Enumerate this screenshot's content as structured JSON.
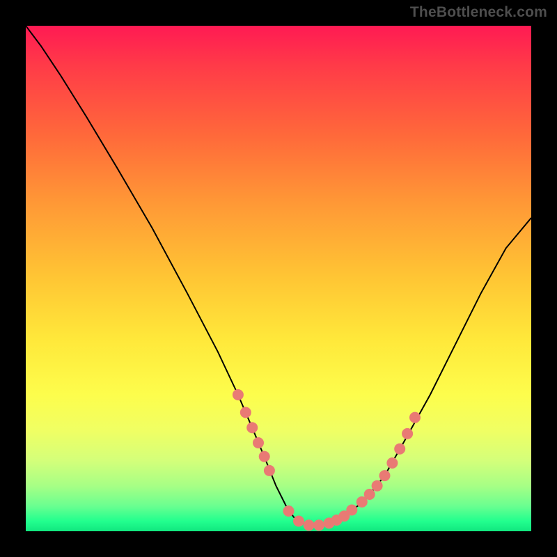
{
  "watermark": "TheBottleneck.com",
  "chart_data": {
    "type": "line",
    "title": "",
    "xlabel": "",
    "ylabel": "",
    "xlim": [
      0,
      100
    ],
    "ylim": [
      0,
      100
    ],
    "grid": false,
    "curve_color": "#000000",
    "marker_color": "#e97a74",
    "series": [
      {
        "name": "curve",
        "x": [
          0,
          3,
          7,
          12,
          18,
          25,
          32,
          38,
          42,
          45,
          47.5,
          49.5,
          51.5,
          53,
          55,
          57,
          60,
          63,
          67,
          71,
          75,
          80,
          85,
          90,
          95,
          100
        ],
        "y": [
          100,
          96,
          90,
          82,
          72,
          60,
          47,
          35.5,
          27,
          20,
          14,
          9,
          5,
          2.8,
          1.5,
          1.2,
          1.6,
          3,
          6,
          11,
          18,
          27,
          37,
          47,
          56,
          62
        ]
      }
    ],
    "markers": [
      {
        "x": 42.0,
        "y": 27.0
      },
      {
        "x": 43.5,
        "y": 23.5
      },
      {
        "x": 44.8,
        "y": 20.5
      },
      {
        "x": 46.0,
        "y": 17.5
      },
      {
        "x": 47.2,
        "y": 14.8
      },
      {
        "x": 48.2,
        "y": 12.0
      },
      {
        "x": 52.0,
        "y": 4.0
      },
      {
        "x": 54.0,
        "y": 2.0
      },
      {
        "x": 56.0,
        "y": 1.2
      },
      {
        "x": 58.0,
        "y": 1.2
      },
      {
        "x": 60.0,
        "y": 1.6
      },
      {
        "x": 61.5,
        "y": 2.2
      },
      {
        "x": 63.0,
        "y": 3.0
      },
      {
        "x": 64.5,
        "y": 4.2
      },
      {
        "x": 66.5,
        "y": 5.8
      },
      {
        "x": 68.0,
        "y": 7.3
      },
      {
        "x": 69.5,
        "y": 9.0
      },
      {
        "x": 71.0,
        "y": 11.0
      },
      {
        "x": 72.5,
        "y": 13.5
      },
      {
        "x": 74.0,
        "y": 16.3
      },
      {
        "x": 75.5,
        "y": 19.3
      },
      {
        "x": 77.0,
        "y": 22.5
      }
    ]
  }
}
